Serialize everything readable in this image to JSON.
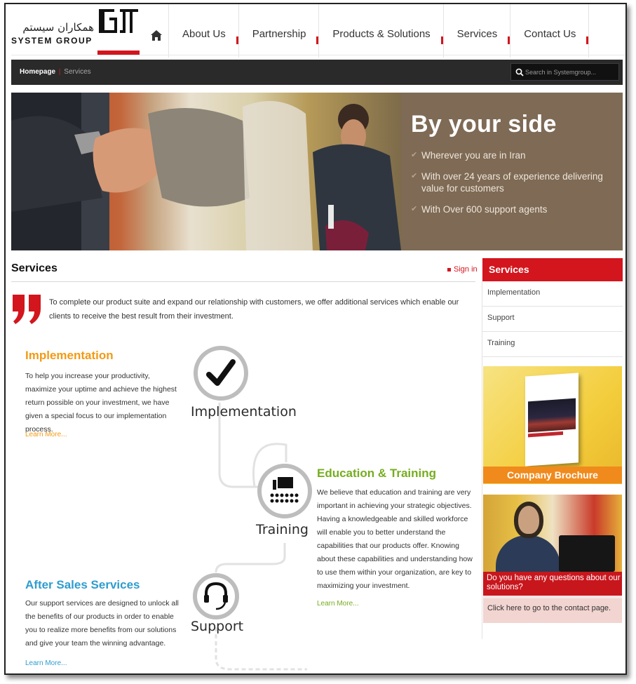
{
  "header": {
    "logo_fa": "همکاران سیستم",
    "logo_en": "SYSTEM GROUP",
    "nav": [
      "About Us",
      "Partnership",
      "Products & Solutions",
      "Services",
      "Contact Us"
    ]
  },
  "breadcrumb": {
    "home": "Homepage",
    "separator": "|",
    "current": "Services"
  },
  "search": {
    "placeholder": "Search in Systemgroup..."
  },
  "hero": {
    "title": "By your side",
    "points": [
      "Wherever you are in Iran",
      "With over 24 years of experience delivering value for customers",
      "With Over 600 support agents"
    ]
  },
  "main": {
    "title": "Services",
    "signin": "Sign in",
    "intro": "To complete our product suite and expand our relationship with customers, we offer additional services which enable our clients to receive the best result from their investment.",
    "implementation": {
      "title": "Implementation",
      "text": "To help you increase your productivity, maximize your uptime and achieve the highest return possible on your investment, we have given a special focus to our implementation process.",
      "learn_more": "Learn More..."
    },
    "education": {
      "title": "Education & Training",
      "text": "We believe that education and training are very important in achieving your strategic objectives. Having a knowledgeable and skilled workforce will enable you to better understand the capabilities that our products offer. Knowing about these capabilities and understanding how to use them within your organization, are key to maximizing your investment.",
      "learn_more": "Learn More..."
    },
    "after_sales": {
      "title": "After Sales Services",
      "text": "Our support services are designed to unlock all the benefits of our products in order to enable you to realize more benefits from our solutions and give your team the winning advantage.",
      "learn_more": "Learn More..."
    },
    "flow_labels": {
      "implementation": "Implementation",
      "training": "Training",
      "support": "Support"
    }
  },
  "sidebar": {
    "title": "Services",
    "items": [
      "Implementation",
      "Support",
      "Training"
    ],
    "brochure": "Company Brochure",
    "contact_question": "Do you have any questions about our solutions?",
    "contact_link": "Click here to go to the contact page."
  },
  "colors": {
    "brand_red": "#d3151d",
    "implementation_orange": "#f29a14",
    "education_green": "#76ad1f",
    "after_sales_blue": "#2e9dcf",
    "hero_panel": "#7e6a55",
    "bar_dark": "#2a2a2a"
  }
}
